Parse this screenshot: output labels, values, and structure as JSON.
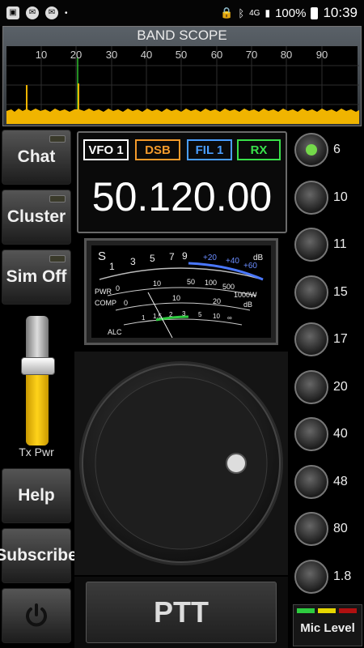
{
  "statusbar": {
    "network_label": "4G",
    "battery": "100%",
    "time": "10:39"
  },
  "scope": {
    "title": "BAND SCOPE",
    "ticks": [
      "10",
      "20",
      "30",
      "40",
      "50",
      "60",
      "70",
      "80",
      "90"
    ]
  },
  "side_buttons": {
    "chat": "Chat",
    "cluster": "Cluster",
    "sim": "Sim Off",
    "help": "Help",
    "subscribe": "Subscribe"
  },
  "tx_power": {
    "label": "Tx Pwr",
    "level_percent": 62
  },
  "display": {
    "vfo": "VFO 1",
    "mode": "DSB",
    "filter": "FIL 1",
    "rxtx": "RX",
    "frequency": "50.120.00"
  },
  "meter": {
    "s_label": "S",
    "s_scale": [
      "1",
      "3",
      "5",
      "7",
      "9",
      "+20",
      "+40",
      "+60",
      "dB"
    ],
    "pwr_label": "PWR",
    "pwr_scale": [
      "0",
      "10",
      "50",
      "100",
      "500",
      "1000W"
    ],
    "comp_label": "COMP",
    "comp_scale": [
      "0",
      "10",
      "20",
      "dB"
    ],
    "alc_label": "ALC",
    "alc_scale": [
      "1",
      "1.5",
      "2",
      "3",
      "5",
      "10",
      "∞"
    ]
  },
  "ptt_label": "PTT",
  "bands": [
    {
      "label": "6",
      "active": true
    },
    {
      "label": "10",
      "active": false
    },
    {
      "label": "11",
      "active": false
    },
    {
      "label": "15",
      "active": false
    },
    {
      "label": "17",
      "active": false
    },
    {
      "label": "20",
      "active": false
    },
    {
      "label": "40",
      "active": false
    },
    {
      "label": "48",
      "active": false
    },
    {
      "label": "80",
      "active": false
    },
    {
      "label": "1.8",
      "active": false
    }
  ],
  "mic_level": {
    "label": "Mic Level"
  },
  "colors": {
    "vfo": "#ffffff",
    "mode": "#f39a2b",
    "filter": "#4a9eff",
    "rx": "#39e04a",
    "spectrum": "#f0b400",
    "band_led_active": "#74d84a",
    "band_led_idle": "#1e1e1e"
  }
}
